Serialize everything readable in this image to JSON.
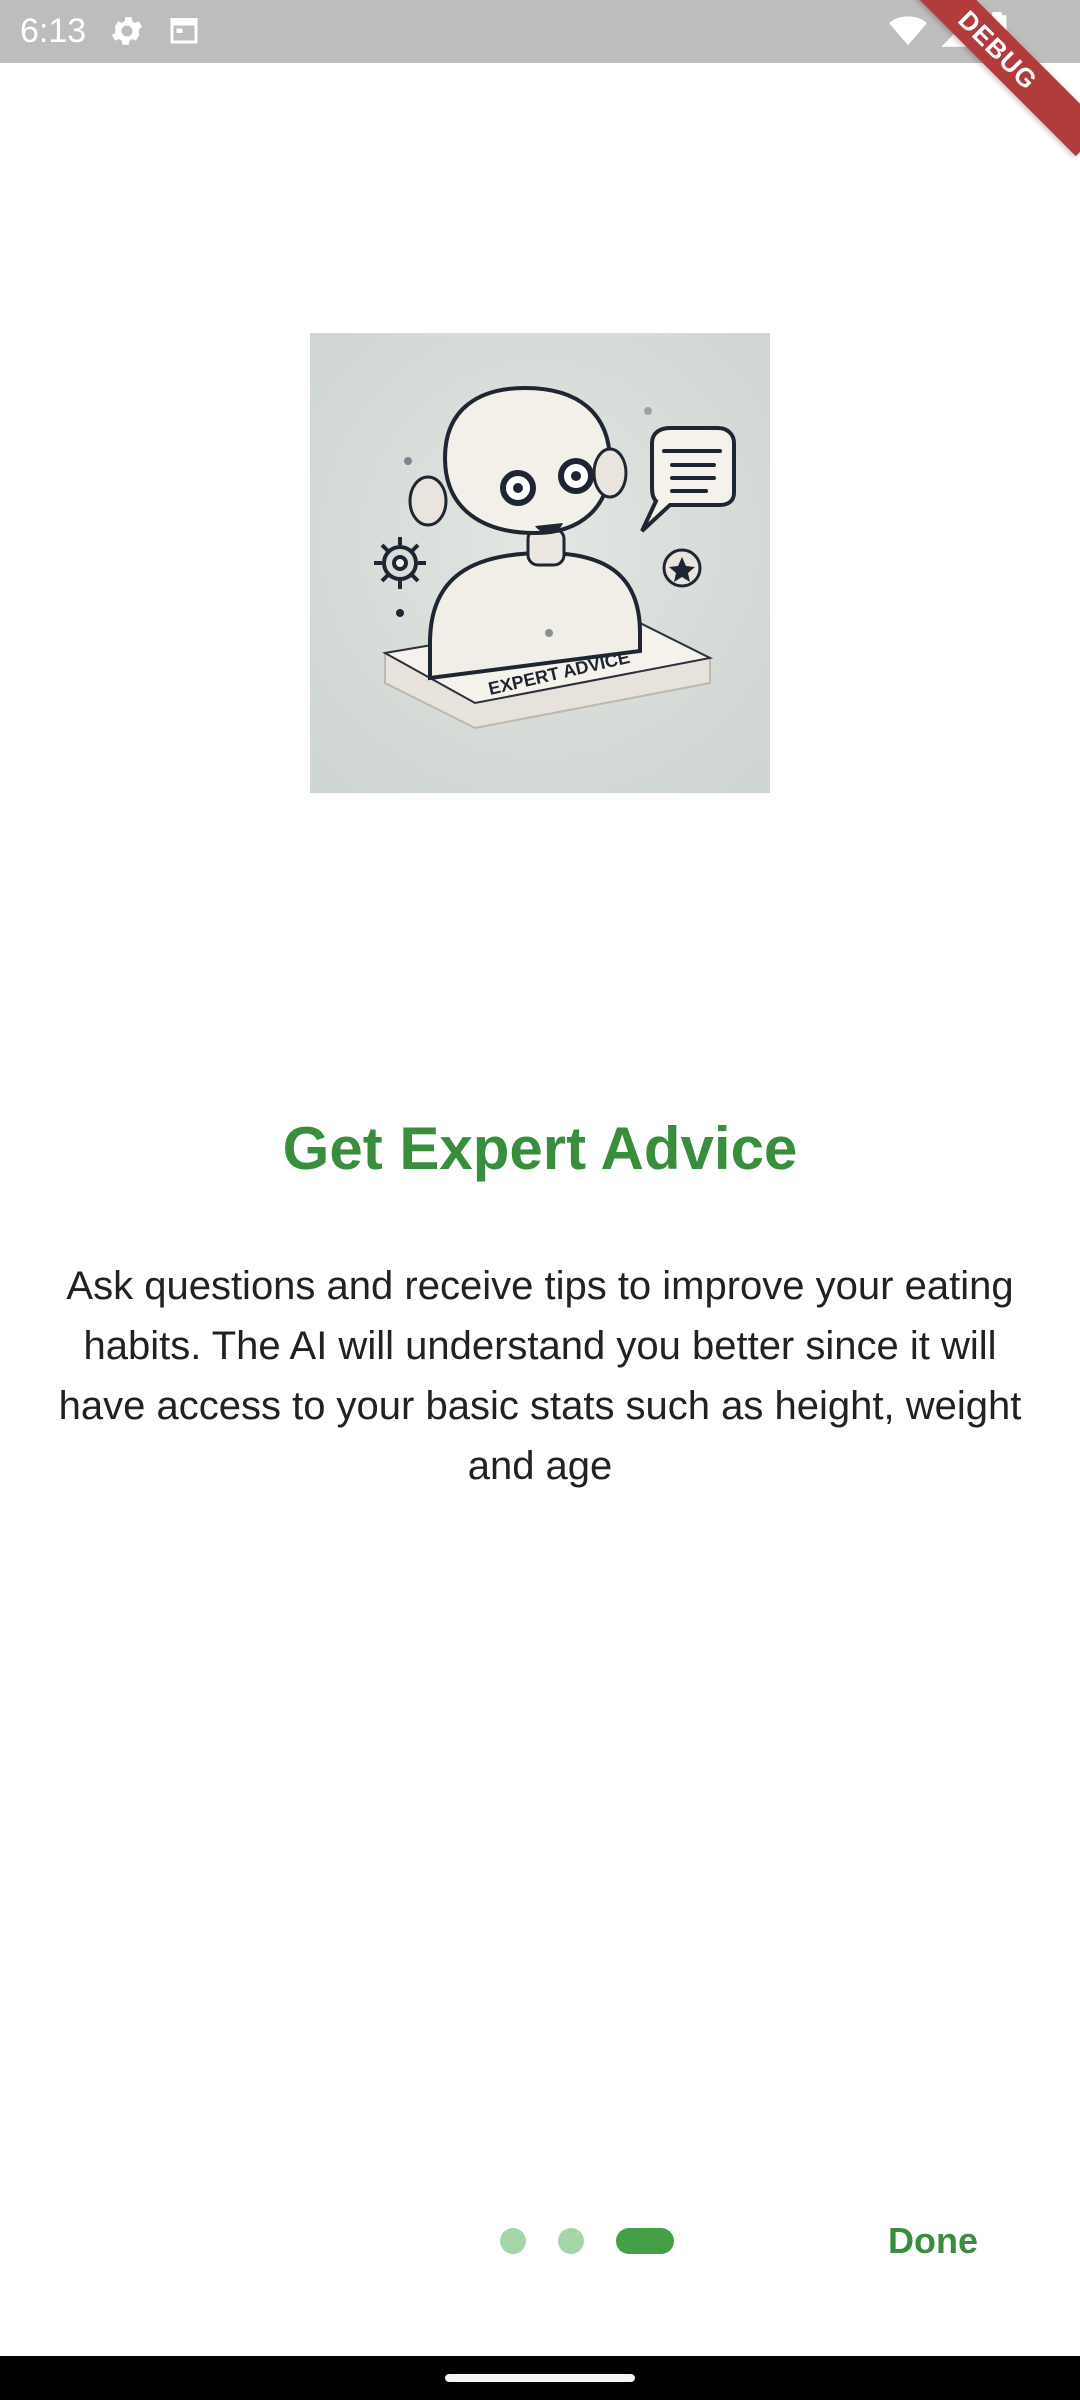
{
  "status_bar": {
    "time": "6:13",
    "icons": [
      "gear-icon",
      "calendar-icon",
      "wifi-icon",
      "signal-icon",
      "battery-icon"
    ]
  },
  "debug_banner": {
    "label": "DEBUG"
  },
  "illustration": {
    "icon": "robot-expert-illustration",
    "caption": "EXPERT ADVICE"
  },
  "onboarding": {
    "title": "Get Expert Advice",
    "body": "Ask questions and receive tips to improve your eating habits. The AI will understand you better since it will have access to your basic stats such as height, weight and age"
  },
  "navigation": {
    "page_count": 3,
    "active_page": 3,
    "done_label": "Done"
  },
  "colors": {
    "accent": "#388e3c",
    "dot_active": "#43a047",
    "dot_inactive": "#a5d6a7",
    "status_bar": "#bdbdbd",
    "debug_banner": "#b23b3b"
  }
}
